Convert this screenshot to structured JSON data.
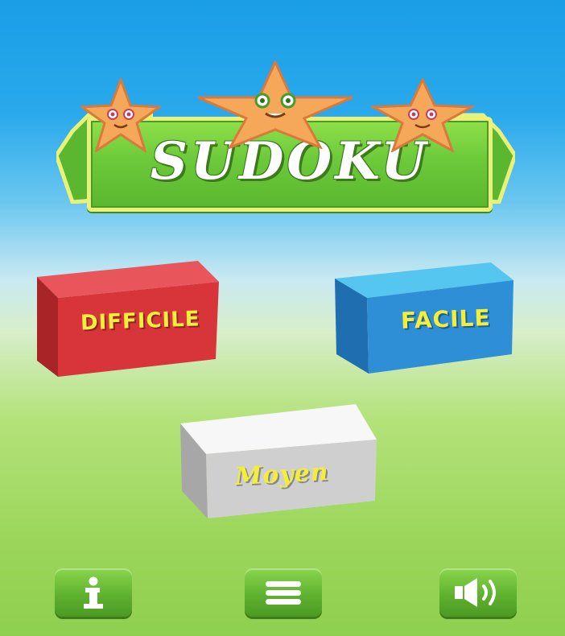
{
  "logo": {
    "title": "SUDOKU"
  },
  "difficulty": {
    "hard_label": "DIFFICILE",
    "easy_label": "FACILE",
    "medium_label": "Moyen"
  },
  "footer": {
    "info_icon": "info-icon",
    "menu_icon": "menu-icon",
    "sound_icon": "speaker-icon"
  },
  "colors": {
    "hard": "#d8353b",
    "easy": "#2f8fd6",
    "medium": "#e6e6e6",
    "label": "#f3ee3a",
    "button_green": "#5fb22f"
  }
}
